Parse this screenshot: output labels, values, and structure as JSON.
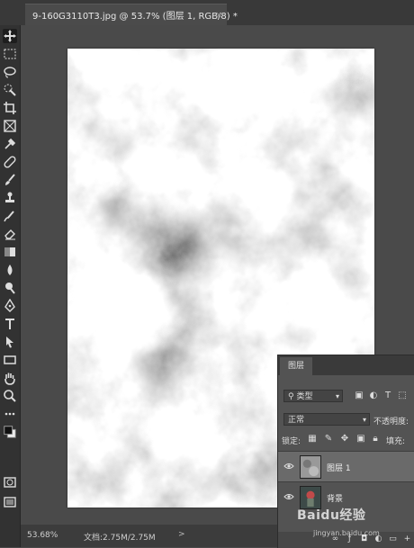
{
  "document_tab": {
    "title": "9-160G3110T3.jpg @ 53.7% (图层 1, RGB/8) *",
    "close": "×"
  },
  "toolbar": {
    "tools": [
      "move-tool-icon",
      "marquee-tool-icon",
      "lasso-tool-icon",
      "quick-select-tool-icon",
      "crop-tool-icon",
      "frame-tool-icon",
      "eyedropper-tool-icon",
      "healing-brush-icon",
      "brush-tool-icon",
      "clone-stamp-icon",
      "history-brush-icon",
      "eraser-tool-icon",
      "gradient-tool-icon",
      "blur-tool-icon",
      "dodge-tool-icon",
      "pen-tool-icon",
      "type-tool-icon",
      "path-select-tool-icon",
      "rectangle-tool-icon",
      "hand-tool-icon",
      "zoom-tool-icon",
      "more-tools-icon",
      "color-swatches-icon",
      "quick-mask-icon",
      "screen-mode-icon"
    ]
  },
  "status": {
    "zoom": "53.68%",
    "doc_size": "文档:2.75M/2.75M",
    "arrow": ">"
  },
  "layers_panel": {
    "tab_label": "图层",
    "filter_label": "类型",
    "blend_mode": "正常",
    "opacity_label": "不透明度:",
    "lock_label": "锁定:",
    "fill_label": "填充:",
    "layers": [
      {
        "name": "图层 1",
        "selected": true
      },
      {
        "name": "背景",
        "selected": false
      }
    ]
  },
  "watermark": {
    "brand": "Baidu经验",
    "url": "jingyan.baidu.com"
  },
  "colors": {
    "app_bg": "#4a4a4a",
    "toolbar_bg": "#323232",
    "panel_bg": "#535353",
    "selected_layer": "#6a6a6a"
  }
}
